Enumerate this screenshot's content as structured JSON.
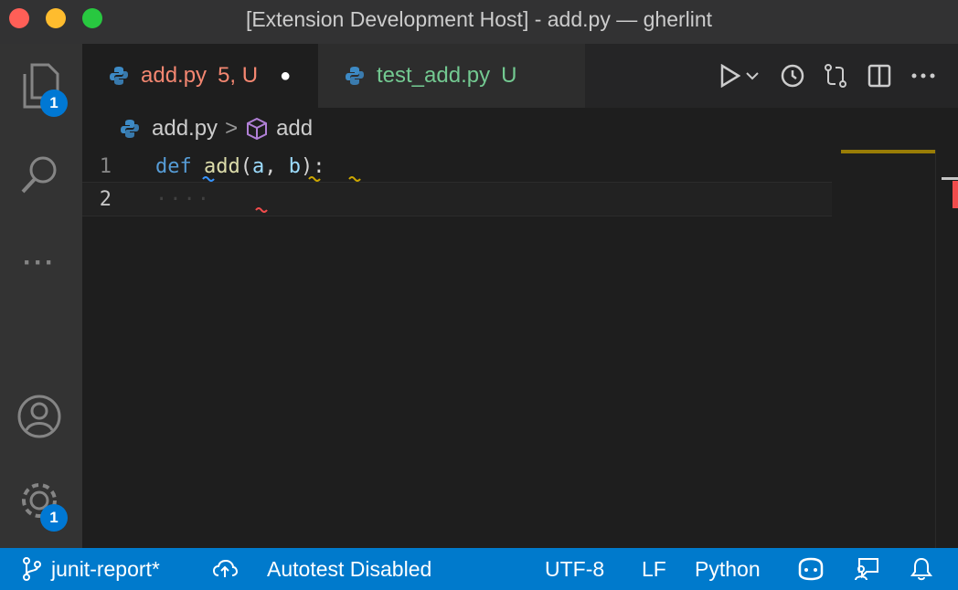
{
  "window": {
    "title": "[Extension Development Host] - add.py — gherlint"
  },
  "activity_bar": {
    "explorer_badge": "1",
    "settings_badge": "1",
    "more_glyph": "···"
  },
  "tabs": [
    {
      "name": "add.py",
      "status": "5, U",
      "dirty_marker": "●",
      "color": "#f48771"
    },
    {
      "name": "test_add.py",
      "status": "U",
      "color": "#73c991"
    }
  ],
  "breadcrumb": {
    "file": "add.py",
    "separator": ">",
    "symbol": "add"
  },
  "editor": {
    "lines": [
      {
        "number": "1",
        "def": "def",
        "name": "add",
        "open": "(",
        "a": "a",
        "comma": ", ",
        "b": "b",
        "close": "):"
      },
      {
        "number": "2",
        "whitespace": "····"
      }
    ]
  },
  "status_bar": {
    "branch": "junit-report*",
    "autotest": "Autotest Disabled",
    "encoding": "UTF-8",
    "eol": "LF",
    "language": "Python"
  },
  "colors": {
    "accent": "#007acc",
    "error": "#f14c4c",
    "warning": "#cca700",
    "info": "#3794ff"
  }
}
